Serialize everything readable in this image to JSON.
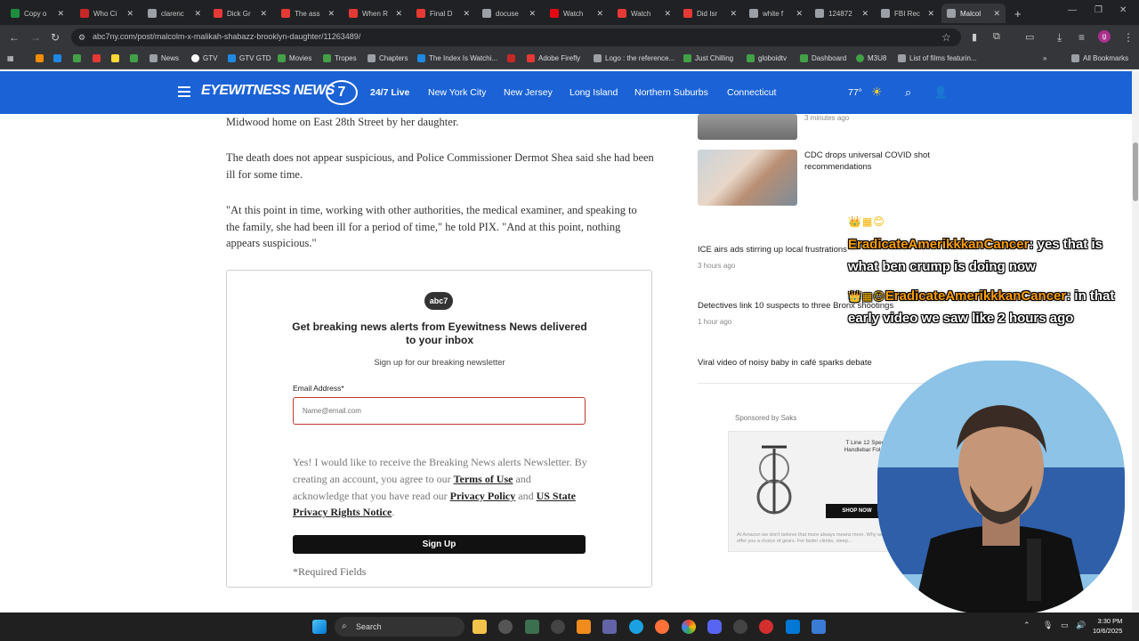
{
  "browser": {
    "tabs": [
      {
        "label": "Copy o",
        "fav_color": "#1e8e3e"
      },
      {
        "label": "Who Ci",
        "fav_color": "#c62828"
      },
      {
        "label": "clarenc",
        "fav_color": "#9aa0a6"
      },
      {
        "label": "Dick Gr",
        "fav_color": "#e53935"
      },
      {
        "label": "The ass",
        "fav_color": "#e53935"
      },
      {
        "label": "When R",
        "fav_color": "#e53935"
      },
      {
        "label": "Final D",
        "fav_color": "#e53935"
      },
      {
        "label": "docuse",
        "fav_color": "#9aa0a6"
      },
      {
        "label": "Watch",
        "fav_color": "#e50914"
      },
      {
        "label": "Watch",
        "fav_color": "#e53935"
      },
      {
        "label": "Did Isr",
        "fav_color": "#e53935"
      },
      {
        "label": "white f",
        "fav_color": "#9aa0a6"
      },
      {
        "label": "124872",
        "fav_color": "#9aa0a6"
      },
      {
        "label": "FBI Rec",
        "fav_color": "#9aa0a6"
      },
      {
        "label": "Malcol",
        "fav_color": "#9aa0a6"
      }
    ],
    "url": "abc7ny.com/post/malcolm-x-malikah-shabazz-brooklyn-daughter/11263489/",
    "bookmarks": [
      {
        "label": "News",
        "color": "#9aa0a6"
      },
      {
        "label": "GTV",
        "color": "#ffffff"
      },
      {
        "label": "GTV GTD",
        "color": "#1e88e5"
      },
      {
        "label": "Movies",
        "color": "#43a047"
      },
      {
        "label": "Tropes",
        "color": "#43a047"
      },
      {
        "label": "Chapters",
        "color": "#9aa0a6"
      },
      {
        "label": "The Index Is Watchi...",
        "color": "#1e88e5"
      },
      {
        "label": "",
        "color": "#c62828"
      },
      {
        "label": "Adobe Firefly",
        "color": "#e53935"
      },
      {
        "label": "Logo : the reference...",
        "color": "#9aa0a6"
      },
      {
        "label": "Just Chilling",
        "color": "#43a047"
      },
      {
        "label": "globoidtv",
        "color": "#43a047"
      },
      {
        "label": "Dashboard",
        "color": "#43a047"
      },
      {
        "label": "M3U8",
        "color": "#43a047"
      },
      {
        "label": "List of films featurin...",
        "color": "#9aa0a6"
      }
    ],
    "all_bookmarks": "All Bookmarks"
  },
  "site": {
    "logo_text": "EYEWITNESS NEWS",
    "logo_number": "7",
    "nav": [
      "24/7 Live",
      "New York City",
      "New Jersey",
      "Long Island",
      "Northern Suburbs",
      "Connecticut"
    ],
    "temperature": "77°",
    "brand_color": "#1a62d6"
  },
  "article": {
    "p0": "Midwood home on East 28th Street by her daughter.",
    "p1": "The death does not appear suspicious, and Police Commissioner Dermot Shea said she had been ill for some time.",
    "p2": "\"At this point in time, working with other authorities, the medical examiner, and speaking to the family, she had been ill for a period of time,\" he told PIX. \"And at this point, nothing appears suspicious.\""
  },
  "newsletter": {
    "logo": "abc7",
    "title": "Get breaking news alerts from Eyewitness News delivered to your inbox",
    "subtitle": "Sign up for our breaking newsletter",
    "email_label": "Email Address*",
    "email_placeholder": "Name@email.com",
    "consent_prefix": "Yes! I would like to receive the Breaking News alerts Newsletter. By creating an account, you agree to our",
    "terms": "Terms of Use",
    "consent_mid": "and acknowledge that you have read our",
    "privacy": "Privacy Policy",
    "and": "and",
    "state_privacy": "US State Privacy Rights Notice",
    "period": ".",
    "signup": "Sign Up",
    "required": "*Required Fields"
  },
  "sidebar": {
    "top_time": "3 minutes ago",
    "stories": [
      {
        "title": "CDC drops universal COVID shot recommendations",
        "time": ""
      },
      {
        "title": "ICE airs ads stirring up local frustrations",
        "time": "3 hours ago"
      },
      {
        "title": "Detectives link 10 suspects to three Bronx shootings",
        "time": "1 hour ago"
      },
      {
        "title": "Viral video of noisy baby in café sparks debate",
        "time": ""
      }
    ],
    "ad": {
      "sponsor": "Sponsored by Saks",
      "product": "T Line 12 Speed Handlebar Foldin",
      "cta": "SHOP NOW",
      "fine": "At Amazon we don't believe that more always means more. Why we offer you a choice of gears. For faster climbs, steep..."
    }
  },
  "chat": [
    {
      "badges": "👑▦😊",
      "user": "EradicateAmerikkkanCancer",
      "text": ": yes that is what ben crump is doing now"
    },
    {
      "badges": "👑▦😊",
      "user": "EradicateAmerikkkanCancer",
      "text": ": in that early video we saw like 2 hours ago"
    }
  ],
  "taskbar": {
    "search": "Search",
    "time": "3:30 PM",
    "date": "10/6/2025"
  }
}
